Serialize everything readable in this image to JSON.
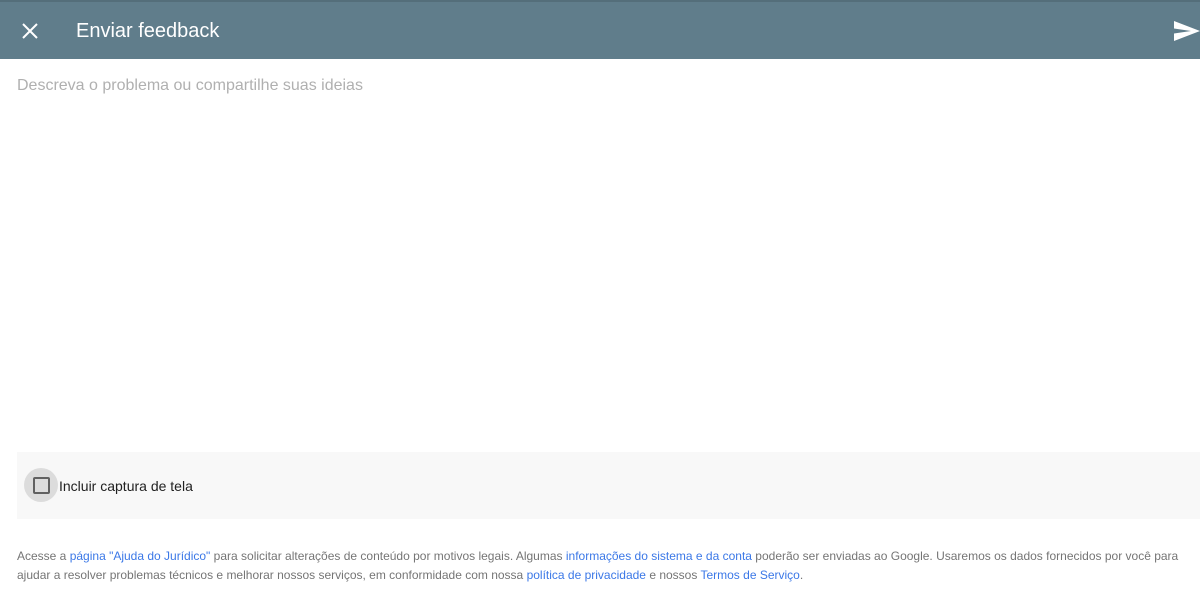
{
  "header": {
    "title": "Enviar feedback",
    "close_icon": "close-icon",
    "send_icon": "send-icon",
    "background": "#607d8b"
  },
  "description": {
    "value": "",
    "placeholder": "Descreva o problema ou compartilhe suas ideias"
  },
  "screenshot_option": {
    "label": "Incluir captura de tela",
    "checked": false
  },
  "legal": {
    "t1": "Acesse a ",
    "l1": "página \"Ajuda do Jurídico\"",
    "t2": " para solicitar alterações de conteúdo por motivos legais. Algumas ",
    "l2": "informações do sistema e da conta",
    "t3": " poderão ser enviadas ao Google. Usaremos os dados fornecidos por você para ajudar a resolver problemas técnicos e melhorar nossos serviços, em conformidade com nossa ",
    "l3": "política de privacidade",
    "t4": " e nossos ",
    "l4": "Termos de Serviço",
    "t5": ".",
    "link_color": "#3b78e7"
  }
}
